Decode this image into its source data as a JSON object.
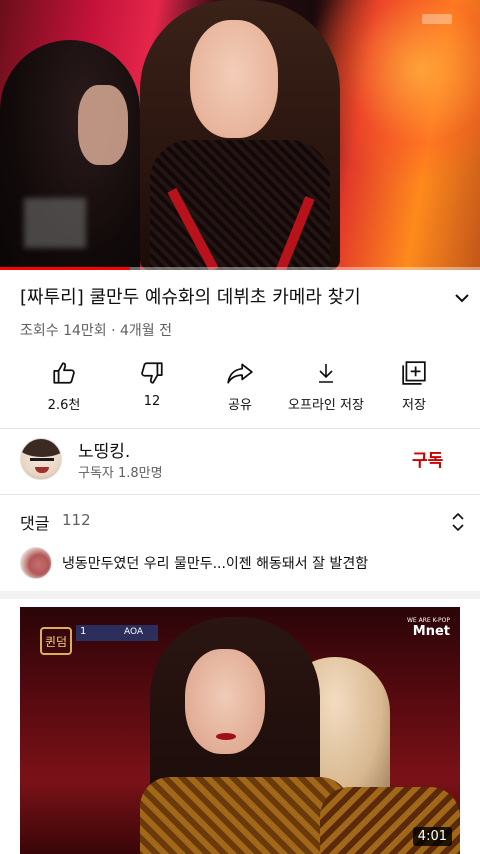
{
  "player": {
    "progress": 0.27
  },
  "video": {
    "title": "[짜투리] 쿨만두 예슈화의 데뷔초 카메라 찾기",
    "meta": "조회수 14만회 · 4개월 전",
    "expand_icon": "chevron-down-icon"
  },
  "actions": [
    {
      "icon": "thumbs-up-icon",
      "label": "2.6천"
    },
    {
      "icon": "thumbs-down-icon",
      "label": "12"
    },
    {
      "icon": "share-icon",
      "label": "공유"
    },
    {
      "icon": "download-icon",
      "label": "오프라인 저장"
    },
    {
      "icon": "add-to-playlist-icon",
      "label": "저장"
    }
  ],
  "channel": {
    "name": "노띵킹.",
    "subscribers": "구독자 1.8만명",
    "subscribe_label": "구독",
    "subscribe_color": "#cc0000"
  },
  "comments": {
    "title": "댓글",
    "count": "112",
    "top_comment": "냉동만두였던 우리 물만두...이젠 해동돼서 잘 발견함",
    "toggle_icon": "unfold-icon"
  },
  "next_video": {
    "duration": "4:01",
    "show_logo": "퀸덤",
    "rank": "1",
    "group": "AOA",
    "network_tag": "WE ARE K-POP",
    "network": "Mnet"
  }
}
